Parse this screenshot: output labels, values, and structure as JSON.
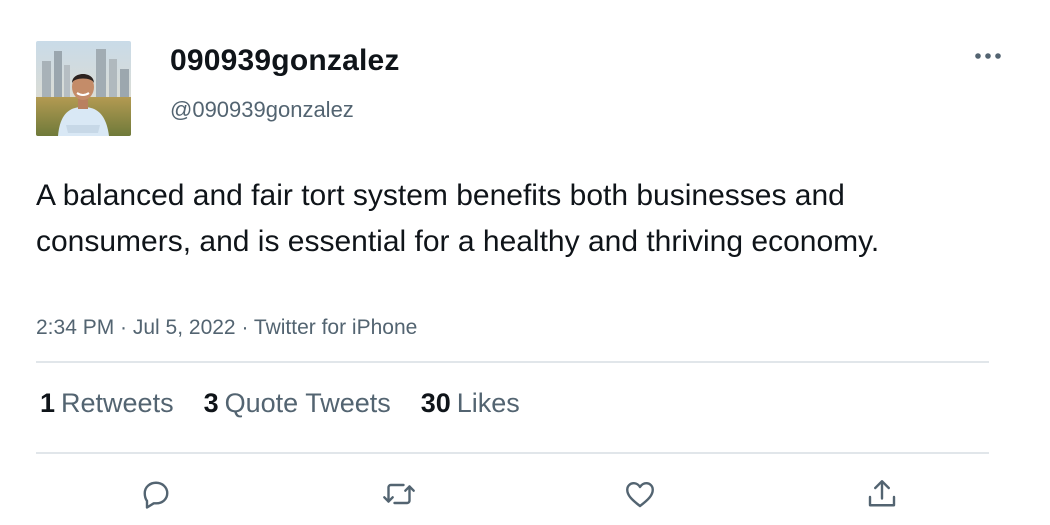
{
  "author": {
    "display_name": "090939gonzalez",
    "handle": "@090939gonzalez"
  },
  "tweet": {
    "text": "A balanced and fair tort system benefits both businesses and consumers, and is essential for a healthy and thriving economy.",
    "timestamp": "2:34 PM · Jul 5, 2022 · Twitter for iPhone"
  },
  "stats": {
    "retweets": {
      "count": "1",
      "label": "Retweets"
    },
    "quotes": {
      "count": "3",
      "label": "Quote Tweets"
    },
    "likes": {
      "count": "30",
      "label": "Likes"
    }
  },
  "icons": {
    "more": "more-options-icon",
    "reply": "reply-icon",
    "retweet": "retweet-icon",
    "like": "heart-icon",
    "share": "share-icon"
  },
  "colors": {
    "text_primary": "#0f1419",
    "text_secondary": "#536471",
    "divider": "#e1e6ea"
  }
}
